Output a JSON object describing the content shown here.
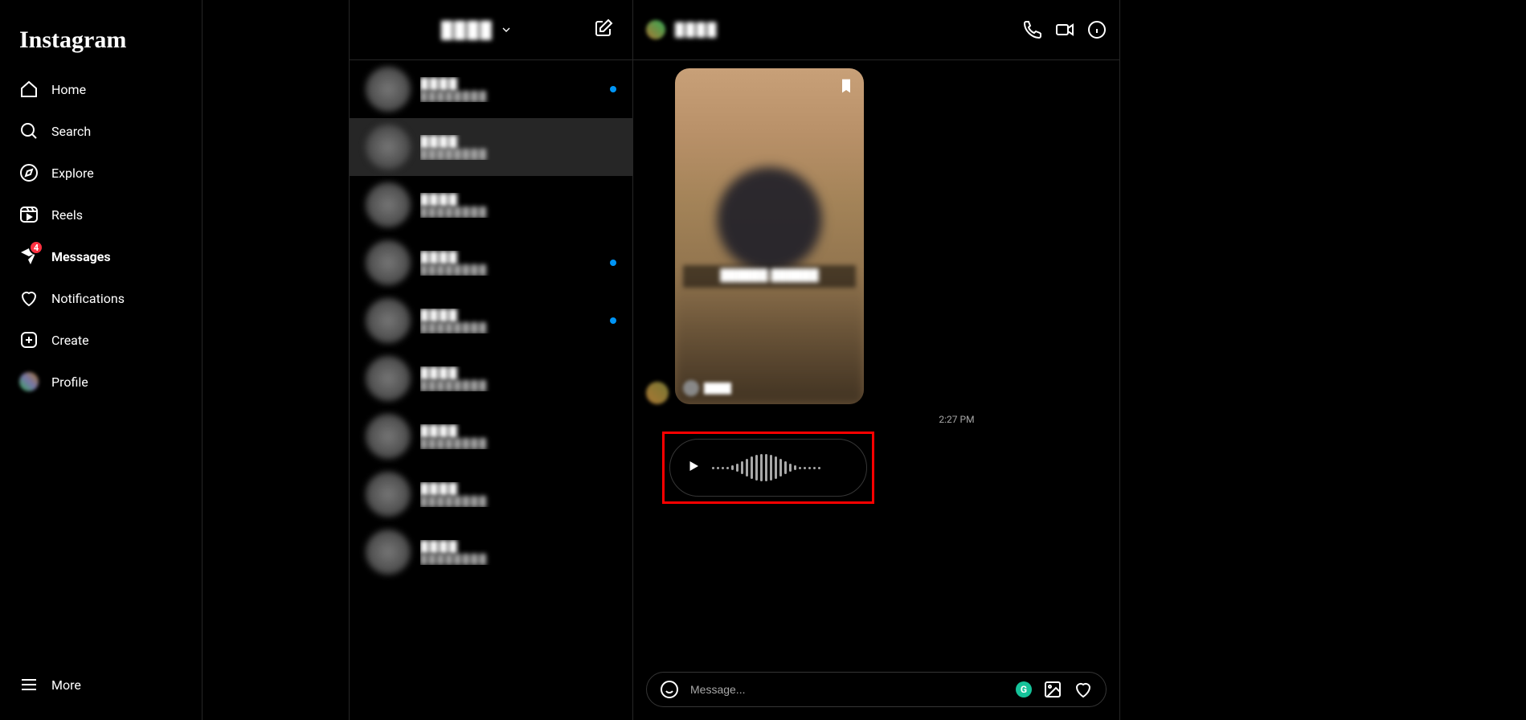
{
  "logo": "Instagram",
  "nav": {
    "home": "Home",
    "search": "Search",
    "explore": "Explore",
    "reels": "Reels",
    "messages": "Messages",
    "notifications": "Notifications",
    "create": "Create",
    "profile": "Profile",
    "more": "More",
    "messages_badge": "4"
  },
  "dm": {
    "account": "████",
    "threads": [
      {
        "name": "████",
        "preview": "████████",
        "unread": true
      },
      {
        "name": "████",
        "preview": "████████",
        "unread": false,
        "selected": true
      },
      {
        "name": "████",
        "preview": "████████",
        "unread": false
      },
      {
        "name": "████",
        "preview": "████████",
        "unread": true
      },
      {
        "name": "████",
        "preview": "████████",
        "unread": true
      },
      {
        "name": "████",
        "preview": "████████",
        "unread": false
      },
      {
        "name": "████",
        "preview": "████████",
        "unread": false
      },
      {
        "name": "████",
        "preview": "████████",
        "unread": false
      },
      {
        "name": "████",
        "preview": "████████",
        "unread": false
      }
    ]
  },
  "chat": {
    "header_name": "████",
    "shared_caption": "██████\n██████",
    "shared_user": "████",
    "timestamp": "2:27 PM",
    "composer_placeholder": "Message..."
  },
  "waveform_heights": [
    3,
    3,
    3,
    3,
    6,
    10,
    16,
    22,
    28,
    32,
    34,
    34,
    32,
    28,
    22,
    16,
    10,
    6,
    3,
    3,
    3,
    3,
    3
  ]
}
